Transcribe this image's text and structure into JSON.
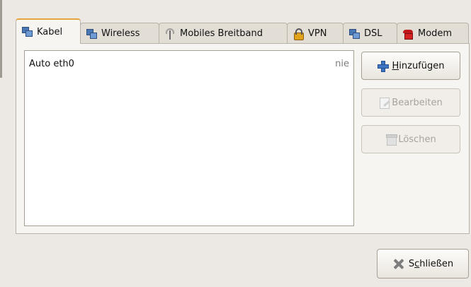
{
  "tabs": [
    {
      "label": "Kabel",
      "icon": "network-wired-icon",
      "active": true
    },
    {
      "label": "Wireless",
      "icon": "network-wireless-icon"
    },
    {
      "label": "Mobiles Breitband",
      "icon": "antenna-icon"
    },
    {
      "label": "VPN",
      "icon": "lock-icon"
    },
    {
      "label": "DSL",
      "icon": "network-dsl-icon"
    },
    {
      "label": "Modem",
      "icon": "phone-icon"
    }
  ],
  "connections": {
    "rows": [
      {
        "name": "Auto eth0",
        "last_used": "nie"
      }
    ]
  },
  "buttons": {
    "add": {
      "mnemonic": "H",
      "rest": "inzufügen"
    },
    "edit": {
      "label": "Bearbeiten"
    },
    "delete": {
      "label": "Löschen"
    },
    "close": {
      "pre": "S",
      "mnemonic": "c",
      "rest": "hließen"
    }
  },
  "colors": {
    "active_tab_accent": "#e8a33c",
    "add_icon": "#3d74c4",
    "modem_icon": "#c0181a"
  }
}
